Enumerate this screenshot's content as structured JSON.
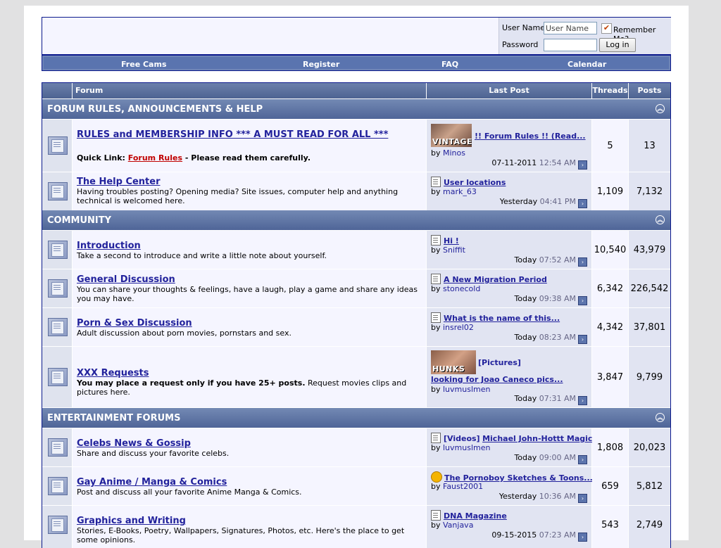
{
  "login": {
    "username_label": "User Name",
    "username_placeholder": "User Name",
    "password_label": "Password",
    "remember_label": "Remember Me?",
    "login_button": "Log in"
  },
  "navbar": [
    "Free Cams",
    "Register",
    "FAQ",
    "Calendar"
  ],
  "table_headers": {
    "forum": "Forum",
    "last_post": "Last Post",
    "threads": "Threads",
    "posts": "Posts"
  },
  "categories": [
    {
      "title": "FORUM RULES, ANNOUNCEMENTS & HELP",
      "forums": [
        {
          "title": "RULES and MEMBERSHIP INFO *** A MUST READ FOR ALL ***",
          "desc_prefix": "Quick Link: ",
          "desc_link": "Forum Rules",
          "desc_suffix": " - Please read them carefully.",
          "last_post": {
            "thumb_label": "VINTAGE",
            "title": "!! Forum Rules !! (Read...",
            "by": "by",
            "user": "Minos",
            "date": "07-11-2011",
            "time": "12:54 AM"
          },
          "threads": "5",
          "posts": "13"
        },
        {
          "title": "The Help Center",
          "desc": "Having troubles posting? Opening media? Site issues, computer help and anything technical is welcomed here.",
          "last_post": {
            "title": "User locations",
            "by": "by",
            "user": "mark_63",
            "date": "Yesterday",
            "time": "04:41 PM"
          },
          "threads": "1,109",
          "posts": "7,132"
        }
      ]
    },
    {
      "title": "COMMUNITY",
      "forums": [
        {
          "title": "Introduction",
          "desc": "Take a second to introduce and write a little note about yourself.",
          "last_post": {
            "title": "Hi !",
            "by": "by",
            "user": "Sniffit",
            "date": "Today",
            "time": "07:52 AM"
          },
          "threads": "10,540",
          "posts": "43,979"
        },
        {
          "title": "General Discussion",
          "desc": "You can share your thoughts & feelings, have a laugh, play a game and share any ideas you may have.",
          "last_post": {
            "title": "A New Migration Period",
            "by": "by",
            "user": "stonecold",
            "date": "Today",
            "time": "09:38 AM"
          },
          "threads": "6,342",
          "posts": "226,542"
        },
        {
          "title": "Porn & Sex Discussion",
          "desc": "Adult discussion about porn movies, pornstars and sex.",
          "last_post": {
            "title": "What is the name of this...",
            "by": "by",
            "user": "insrel02",
            "date": "Today",
            "time": "08:23 AM"
          },
          "threads": "4,342",
          "posts": "37,801"
        },
        {
          "title": "XXX Requests",
          "desc_bold": "You may place a request only if you have 25+ posts.",
          "desc_rest": " Request movies clips and pictures here.",
          "last_post": {
            "thumb_label": "HUNKS",
            "prefix": "[Pictures]",
            "title": "looking for Joao Caneco pics...",
            "by": "by",
            "user": "luvmuslmen",
            "date": "Today",
            "time": "07:31 AM"
          },
          "threads": "3,847",
          "posts": "9,799"
        }
      ]
    },
    {
      "title": "ENTERTAINMENT FORUMS",
      "forums": [
        {
          "title": "Celebs News & Gossip",
          "desc": "Share and discuss your favorite celebs.",
          "last_post": {
            "prefix": "[Videos]",
            "title": "Michael John-Hottt Magician",
            "by": "by",
            "user": "luvmuslmen",
            "date": "Today",
            "time": "09:00 AM"
          },
          "threads": "1,808",
          "posts": "20,023"
        },
        {
          "title": "Gay Anime / Manga & Comics",
          "desc": "Post and discuss all your favorite Anime Manga & Comics.",
          "last_post": {
            "title": "The Pornoboy Sketches & Toons...",
            "by": "by",
            "user": "Faust2001",
            "date": "Yesterday",
            "time": "10:36 AM"
          },
          "threads": "659",
          "posts": "5,812"
        },
        {
          "title": "Graphics and Writing",
          "desc": "Stories, E-Books, Poetry, Wallpapers, Signatures, Photos, etc. Here's the place to get some opinions.",
          "last_post": {
            "title": "DNA Magazine",
            "by": "by",
            "user": "Vanjava",
            "date": "09-15-2015",
            "time": "07:23 AM"
          },
          "threads": "543",
          "posts": "2,749"
        }
      ]
    }
  ]
}
